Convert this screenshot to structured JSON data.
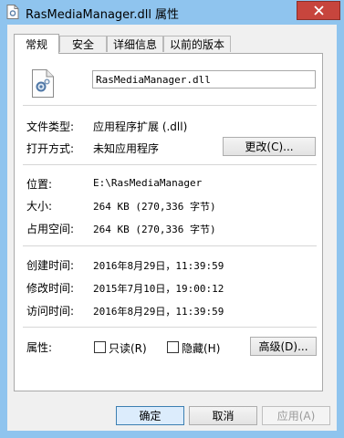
{
  "window": {
    "title": "RasMediaManager.dll 属性"
  },
  "tabs": [
    {
      "label": "常规"
    },
    {
      "label": "安全"
    },
    {
      "label": "详细信息"
    },
    {
      "label": "以前的版本"
    }
  ],
  "general": {
    "file_name": "RasMediaManager.dll",
    "file_type_label": "文件类型:",
    "file_type_value": "应用程序扩展 (.dll)",
    "opens_with_label": "打开方式:",
    "opens_with_value": "未知应用程序",
    "change_button": "更改(C)...",
    "location_label": "位置:",
    "location_value": "E:\\RasMediaManager",
    "size_label": "大小:",
    "size_value": "264 KB (270,336 字节)",
    "size_on_disk_label": "占用空间:",
    "size_on_disk_value": "264 KB (270,336 字节)",
    "created_label": "创建时间:",
    "created_value": "2016年8月29日，11:39:59",
    "modified_label": "修改时间:",
    "modified_value": "2015年7月10日，19:00:12",
    "accessed_label": "访问时间:",
    "accessed_value": "2016年8月29日，11:39:59",
    "attributes_label": "属性:",
    "readonly_label": "只读(R)",
    "hidden_label": "隐藏(H)",
    "advanced_button": "高级(D)..."
  },
  "buttons": {
    "ok": "确定",
    "cancel": "取消",
    "apply": "应用(A)"
  },
  "icons": {
    "title": "dll-file-icon",
    "close": "close-icon",
    "file": "dll-file-gear-icon"
  },
  "colors": {
    "frame": "#8fc4ee",
    "close": "#c7453d"
  }
}
